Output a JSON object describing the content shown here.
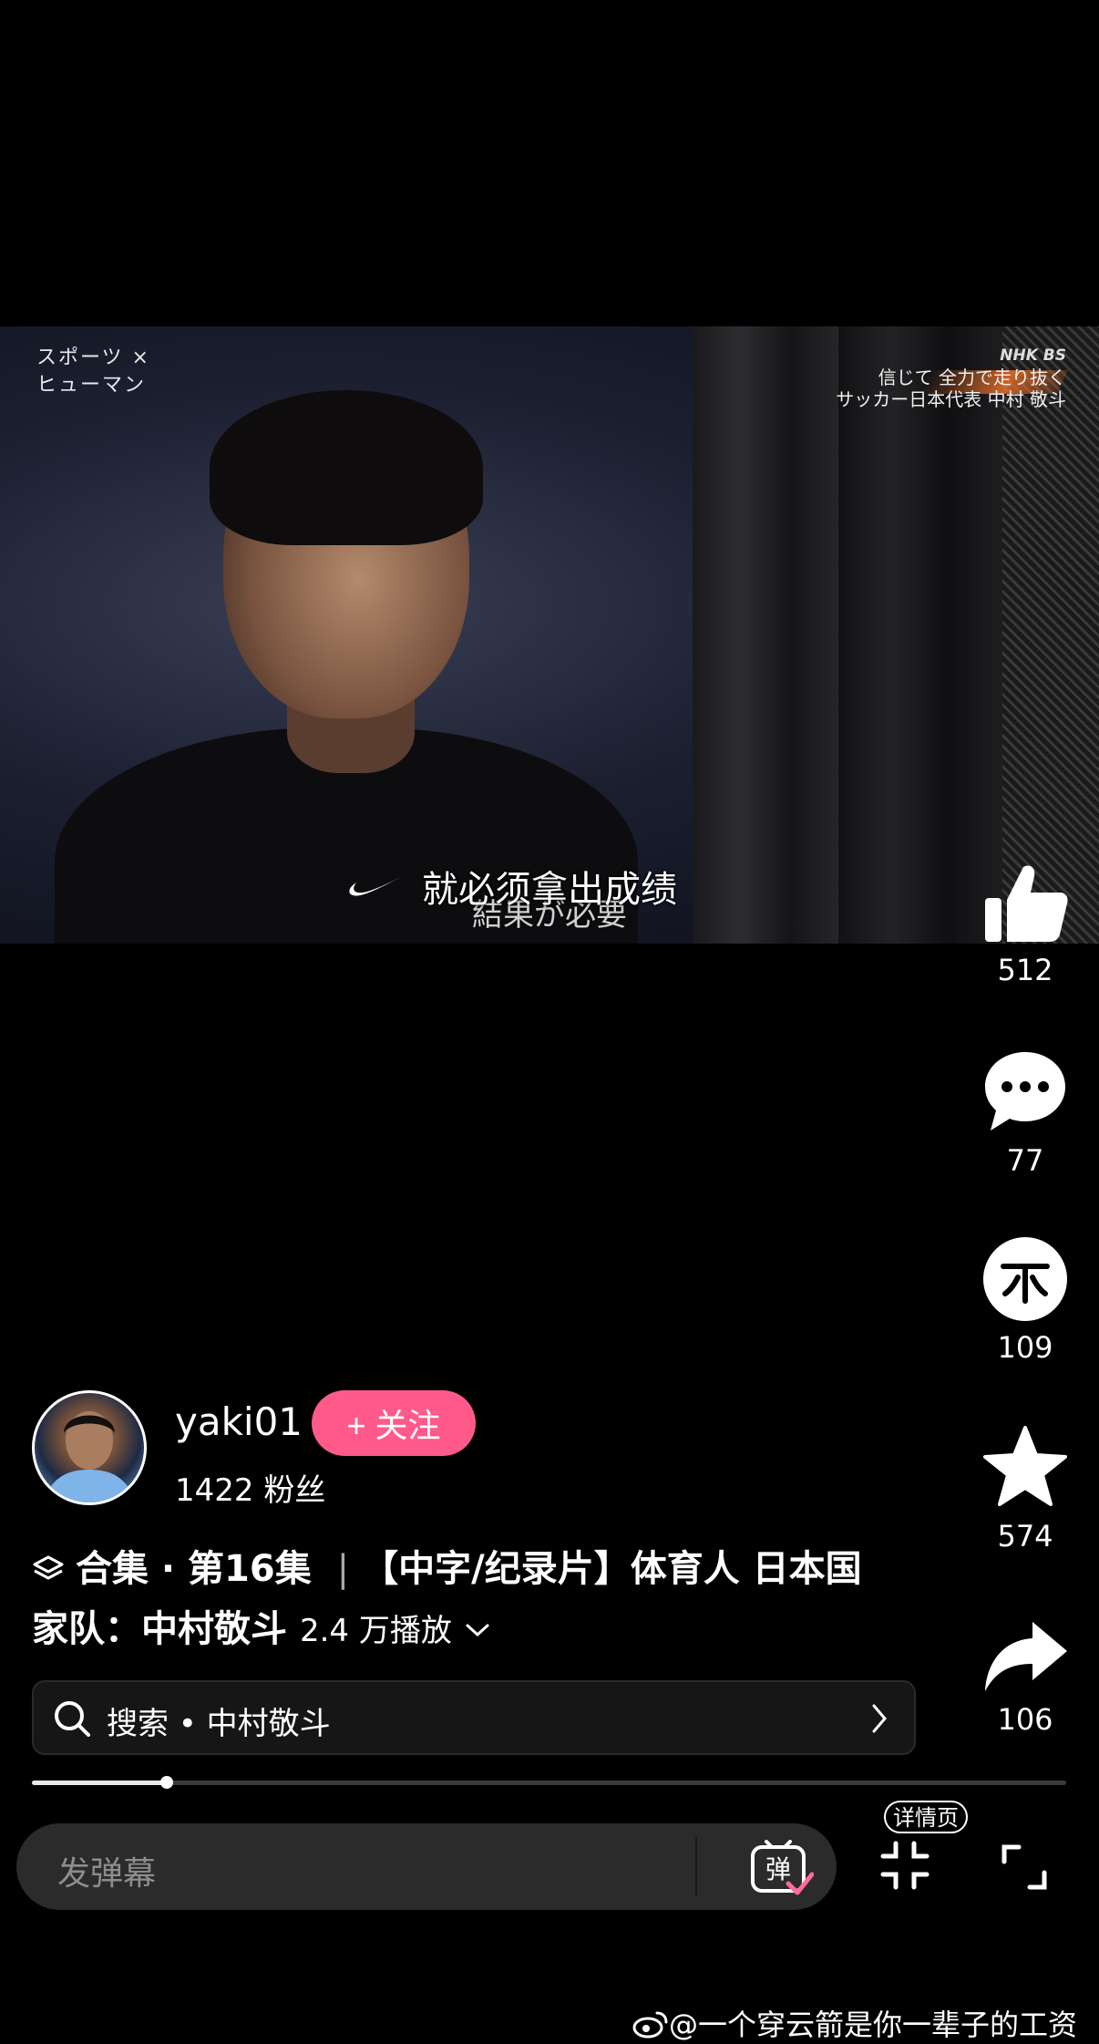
{
  "video": {
    "show_logo": "スポーツ × ヒューマン",
    "broadcaster": "NHK BS",
    "caption_line1": "信じて 全力で走り抜く",
    "caption_line2": "サッカー日本代表 中村 敬斗",
    "subtitle_cn": "就必须拿出成绩",
    "subtitle_jp": "結果が必要"
  },
  "rail": {
    "likes": "512",
    "comments": "77",
    "coins": "109",
    "favorites": "574",
    "shares": "106"
  },
  "author": {
    "username": "yaki01",
    "follow_label": "+ 关注",
    "fans": "1422 粉丝"
  },
  "description": {
    "collection": "合集 · 第16集",
    "title_line1": "【中字/纪录片】体育人 日本国",
    "title_line2": "家队：中村敬斗",
    "plays": "2.4 万播放"
  },
  "search": {
    "text": "搜索 • 中村敬斗"
  },
  "progress": {
    "played_fraction": 0.13
  },
  "bottom": {
    "danmu_placeholder": "发弹幕",
    "danmu_icon_text": "弹",
    "detail_label": "详情页"
  },
  "watermark": "@一个穿云箭是你一辈子的工资"
}
